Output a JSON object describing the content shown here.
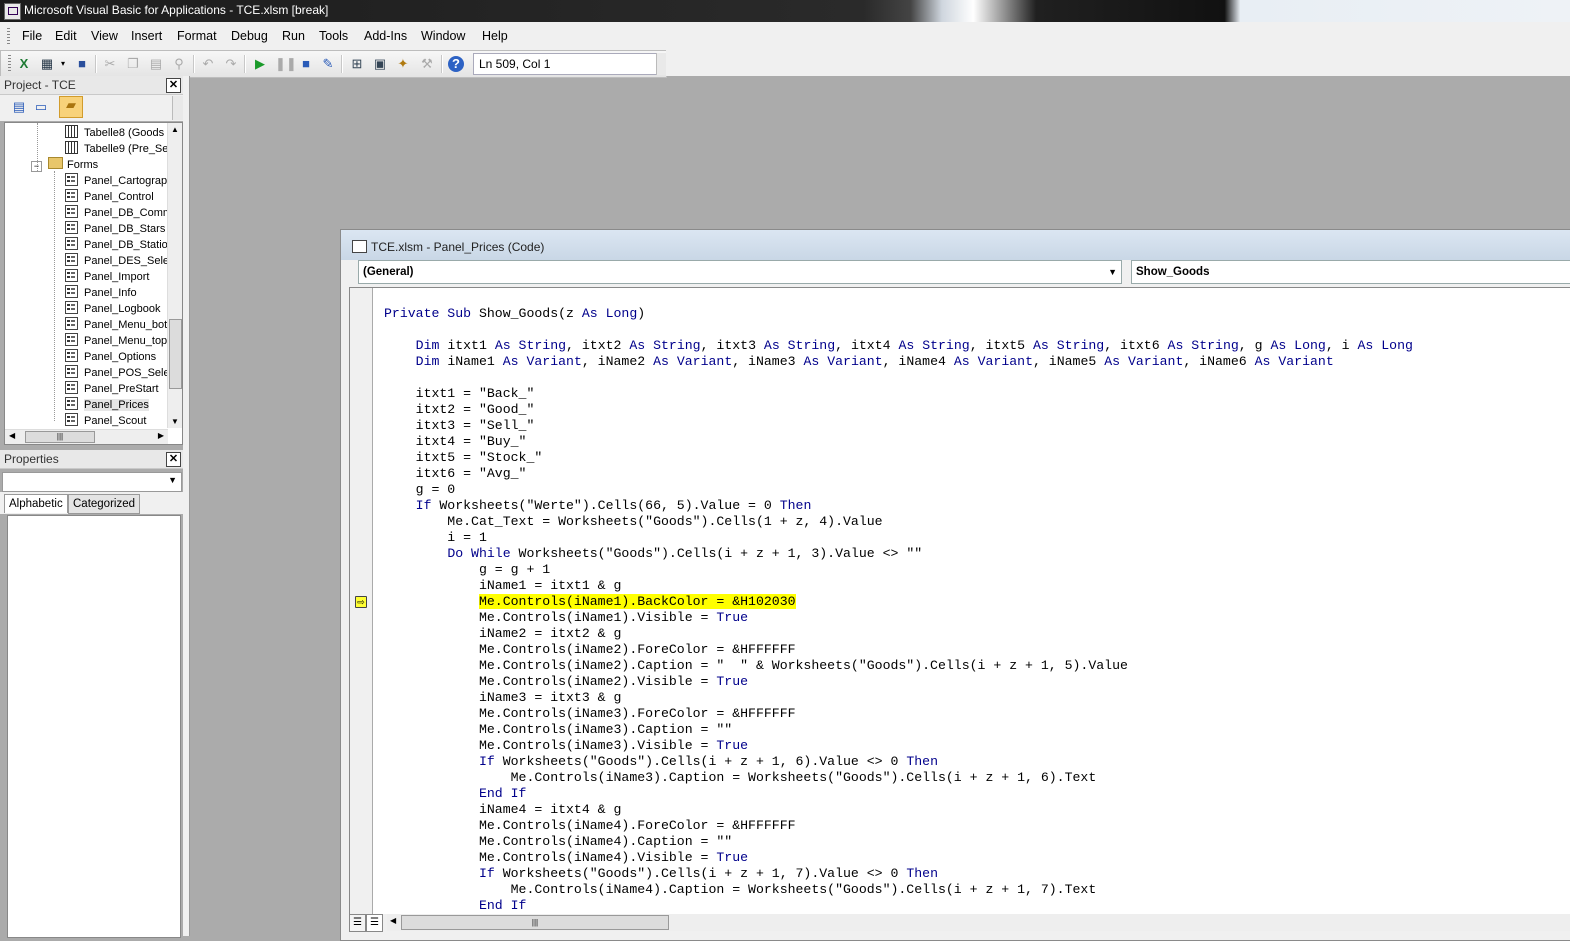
{
  "window": {
    "title": "Microsoft Visual Basic for Applications - TCE.xlsm [break]"
  },
  "menu": [
    "File",
    "Edit",
    "View",
    "Insert",
    "Format",
    "Debug",
    "Run",
    "Tools",
    "Add-Ins",
    "Window",
    "Help"
  ],
  "toolbar": {
    "position": "Ln 509, Col 1",
    "icons": [
      "excel-view-icon",
      "insert-userform-icon",
      "save-icon",
      "cut-icon",
      "copy-icon",
      "paste-icon",
      "find-icon",
      "undo-icon",
      "redo-icon",
      "run-icon",
      "break-icon",
      "reset-icon",
      "design-mode-icon",
      "project-explorer-icon",
      "properties-window-icon",
      "object-browser-icon",
      "toolbox-icon",
      "help-icon"
    ]
  },
  "project": {
    "title": "Project - TCE",
    "items": [
      {
        "label": "Tabelle8 (Goods",
        "type": "sheet"
      },
      {
        "label": "Tabelle9 (Pre_Se",
        "type": "sheet"
      },
      {
        "label": "Forms",
        "type": "folder"
      },
      {
        "label": "Panel_Cartograp",
        "type": "form"
      },
      {
        "label": "Panel_Control",
        "type": "form"
      },
      {
        "label": "Panel_DB_Comm",
        "type": "form"
      },
      {
        "label": "Panel_DB_Stars",
        "type": "form"
      },
      {
        "label": "Panel_DB_Statio",
        "type": "form"
      },
      {
        "label": "Panel_DES_Selec",
        "type": "form"
      },
      {
        "label": "Panel_Import",
        "type": "form"
      },
      {
        "label": "Panel_Info",
        "type": "form"
      },
      {
        "label": "Panel_Logbook",
        "type": "form"
      },
      {
        "label": "Panel_Menu_bot",
        "type": "form"
      },
      {
        "label": "Panel_Menu_top",
        "type": "form"
      },
      {
        "label": "Panel_Options",
        "type": "form"
      },
      {
        "label": "Panel_POS_Sele",
        "type": "form"
      },
      {
        "label": "Panel_PreStart",
        "type": "form"
      },
      {
        "label": "Panel_Prices",
        "type": "form"
      },
      {
        "label": "Panel_Scout",
        "type": "form"
      }
    ]
  },
  "properties": {
    "title": "Properties",
    "tabs": [
      "Alphabetic",
      "Categorized"
    ]
  },
  "code_window": {
    "title": "TCE.xlsm - Panel_Prices (Code)",
    "object_combo": "(General)",
    "proc_combo": "Show_Goods",
    "lines": [
      [
        [
          "k",
          "Private Sub"
        ],
        [
          "t",
          " Show_Goods(z "
        ],
        [
          "k",
          "As Long"
        ],
        [
          "t",
          ")"
        ]
      ],
      [],
      [
        [
          "t",
          "    "
        ],
        [
          "k",
          "Dim"
        ],
        [
          "t",
          " itxt1 "
        ],
        [
          "k",
          "As String"
        ],
        [
          "t",
          ", itxt2 "
        ],
        [
          "k",
          "As String"
        ],
        [
          "t",
          ", itxt3 "
        ],
        [
          "k",
          "As String"
        ],
        [
          "t",
          ", itxt4 "
        ],
        [
          "k",
          "As String"
        ],
        [
          "t",
          ", itxt5 "
        ],
        [
          "k",
          "As String"
        ],
        [
          "t",
          ", itxt6 "
        ],
        [
          "k",
          "As String"
        ],
        [
          "t",
          ", g "
        ],
        [
          "k",
          "As Long"
        ],
        [
          "t",
          ", i "
        ],
        [
          "k",
          "As Long"
        ]
      ],
      [
        [
          "t",
          "    "
        ],
        [
          "k",
          "Dim"
        ],
        [
          "t",
          " iName1 "
        ],
        [
          "k",
          "As Variant"
        ],
        [
          "t",
          ", iName2 "
        ],
        [
          "k",
          "As Variant"
        ],
        [
          "t",
          ", iName3 "
        ],
        [
          "k",
          "As Variant"
        ],
        [
          "t",
          ", iName4 "
        ],
        [
          "k",
          "As Variant"
        ],
        [
          "t",
          ", iName5 "
        ],
        [
          "k",
          "As Variant"
        ],
        [
          "t",
          ", iName6 "
        ],
        [
          "k",
          "As Variant"
        ]
      ],
      [],
      [
        [
          "t",
          "    itxt1 = \"Back_\""
        ]
      ],
      [
        [
          "t",
          "    itxt2 = \"Good_\""
        ]
      ],
      [
        [
          "t",
          "    itxt3 = \"Sell_\""
        ]
      ],
      [
        [
          "t",
          "    itxt4 = \"Buy_\""
        ]
      ],
      [
        [
          "t",
          "    itxt5 = \"Stock_\""
        ]
      ],
      [
        [
          "t",
          "    itxt6 = \"Avg_\""
        ]
      ],
      [
        [
          "t",
          "    g = 0"
        ]
      ],
      [
        [
          "t",
          "    "
        ],
        [
          "k",
          "If"
        ],
        [
          "t",
          " Worksheets(\"Werte\").Cells(66, 5).Value = 0 "
        ],
        [
          "k",
          "Then"
        ]
      ],
      [
        [
          "t",
          "        Me.Cat_Text = Worksheets(\"Goods\").Cells(1 + z, 4).Value"
        ]
      ],
      [
        [
          "t",
          "        i = 1"
        ]
      ],
      [
        [
          "t",
          "        "
        ],
        [
          "k",
          "Do While"
        ],
        [
          "t",
          " Worksheets(\"Goods\").Cells(i + z + 1, 3).Value <> \"\""
        ]
      ],
      [
        [
          "t",
          "            g = g + 1"
        ]
      ],
      [
        [
          "t",
          "            iName1 = itxt1 & g"
        ]
      ],
      [
        [
          "t",
          "            "
        ],
        [
          "h",
          "Me.Controls(iName1).BackColor = &H102030"
        ]
      ],
      [
        [
          "t",
          "            Me.Controls(iName1).Visible = "
        ],
        [
          "k",
          "True"
        ]
      ],
      [
        [
          "t",
          "            iName2 = itxt2 & g"
        ]
      ],
      [
        [
          "t",
          "            Me.Controls(iName2).ForeColor = &HFFFFFF"
        ]
      ],
      [
        [
          "t",
          "            Me.Controls(iName2).Caption = \"  \" & Worksheets(\"Goods\").Cells(i + z + 1, 5).Value"
        ]
      ],
      [
        [
          "t",
          "            Me.Controls(iName2).Visible = "
        ],
        [
          "k",
          "True"
        ]
      ],
      [
        [
          "t",
          "            iName3 = itxt3 & g"
        ]
      ],
      [
        [
          "t",
          "            Me.Controls(iName3).ForeColor = &HFFFFFF"
        ]
      ],
      [
        [
          "t",
          "            Me.Controls(iName3).Caption = \"\""
        ]
      ],
      [
        [
          "t",
          "            Me.Controls(iName3).Visible = "
        ],
        [
          "k",
          "True"
        ]
      ],
      [
        [
          "t",
          "            "
        ],
        [
          "k",
          "If"
        ],
        [
          "t",
          " Worksheets(\"Goods\").Cells(i + z + 1, 6).Value <> 0 "
        ],
        [
          "k",
          "Then"
        ]
      ],
      [
        [
          "t",
          "                Me.Controls(iName3).Caption = Worksheets(\"Goods\").Cells(i + z + 1, 6).Text"
        ]
      ],
      [
        [
          "t",
          "            "
        ],
        [
          "k",
          "End If"
        ]
      ],
      [
        [
          "t",
          "            iName4 = itxt4 & g"
        ]
      ],
      [
        [
          "t",
          "            Me.Controls(iName4).ForeColor = &HFFFFFF"
        ]
      ],
      [
        [
          "t",
          "            Me.Controls(iName4).Caption = \"\""
        ]
      ],
      [
        [
          "t",
          "            Me.Controls(iName4).Visible = "
        ],
        [
          "k",
          "True"
        ]
      ],
      [
        [
          "t",
          "            "
        ],
        [
          "k",
          "If"
        ],
        [
          "t",
          " Worksheets(\"Goods\").Cells(i + z + 1, 7).Value <> 0 "
        ],
        [
          "k",
          "Then"
        ]
      ],
      [
        [
          "t",
          "                Me.Controls(iName4).Caption = Worksheets(\"Goods\").Cells(i + z + 1, 7).Text"
        ]
      ],
      [
        [
          "t",
          "            "
        ],
        [
          "k",
          "End If"
        ]
      ]
    ]
  }
}
